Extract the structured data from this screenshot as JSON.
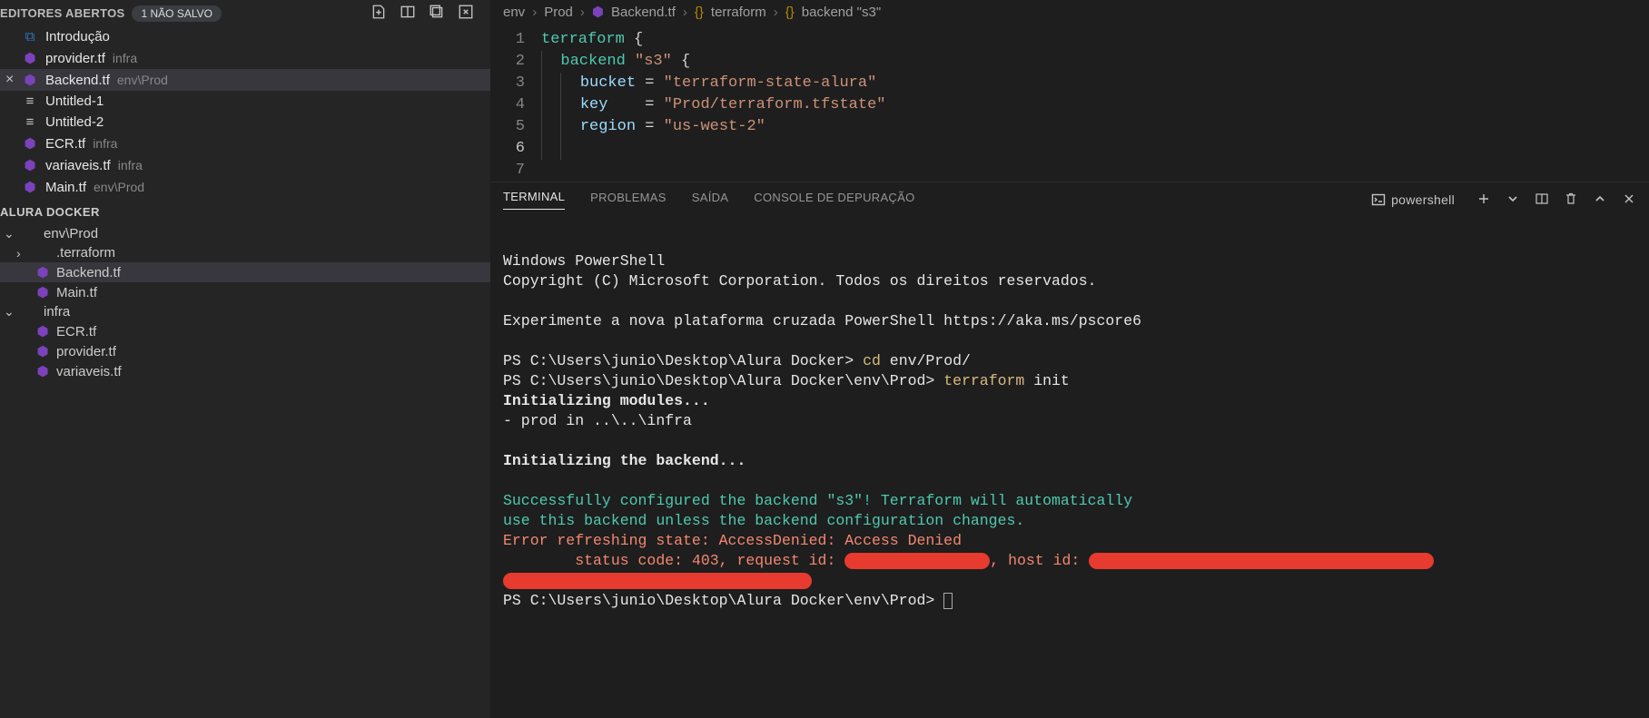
{
  "sidebar": {
    "open_editors_title": "EDITORES ABERTOS",
    "unsaved_badge": "1 NÃO SALVO",
    "items": [
      {
        "label": "Introdução",
        "path": "",
        "icon": "vs",
        "active": false
      },
      {
        "label": "provider.tf",
        "path": "infra",
        "icon": "tf",
        "active": false
      },
      {
        "label": "Backend.tf",
        "path": "env\\Prod",
        "icon": "tf",
        "active": true,
        "closeable": true
      },
      {
        "label": "Untitled-1",
        "path": "",
        "icon": "unt",
        "active": false
      },
      {
        "label": "Untitled-2",
        "path": "",
        "icon": "unt",
        "active": false
      },
      {
        "label": "ECR.tf",
        "path": "infra",
        "icon": "tf",
        "active": false
      },
      {
        "label": "variaveis.tf",
        "path": "infra",
        "icon": "tf",
        "active": false
      },
      {
        "label": "Main.tf",
        "path": "env\\Prod",
        "icon": "tf",
        "active": false
      }
    ],
    "explorer_title": "ALURA DOCKER",
    "tree": [
      {
        "label": "env\\Prod",
        "kind": "folder",
        "chev": "down",
        "indent": 1
      },
      {
        "label": ".terraform",
        "kind": "folder",
        "chev": "right",
        "indent": 2
      },
      {
        "label": "Backend.tf",
        "kind": "tf",
        "indent": 2,
        "active": true
      },
      {
        "label": "Main.tf",
        "kind": "tf",
        "indent": 2
      },
      {
        "label": "infra",
        "kind": "folder",
        "chev": "down",
        "indent": 1
      },
      {
        "label": "ECR.tf",
        "kind": "tf",
        "indent": 2
      },
      {
        "label": "provider.tf",
        "kind": "tf",
        "indent": 2
      },
      {
        "label": "variaveis.tf",
        "kind": "tf",
        "indent": 2
      }
    ]
  },
  "breadcrumbs": {
    "parts": [
      "env",
      "Prod",
      "Backend.tf",
      "terraform",
      "backend \"s3\""
    ]
  },
  "code": {
    "lines": [
      {
        "n": 1,
        "tokens": [
          [
            "kw",
            "terraform"
          ],
          [
            "pun",
            " {"
          ]
        ]
      },
      {
        "n": 2,
        "tokens": [
          [
            "pad",
            "  "
          ],
          [
            "kw",
            "backend"
          ],
          [
            "pun",
            " "
          ],
          [
            "str",
            "\"s3\""
          ],
          [
            "pun",
            " {"
          ]
        ]
      },
      {
        "n": 3,
        "tokens": [
          [
            "pad",
            "    "
          ],
          [
            "id",
            "bucket"
          ],
          [
            "pun",
            " = "
          ],
          [
            "str",
            "\"terraform-state-alura\""
          ]
        ]
      },
      {
        "n": 4,
        "tokens": [
          [
            "pad",
            "    "
          ],
          [
            "id",
            "key"
          ],
          [
            "pun",
            "    = "
          ],
          [
            "str",
            "\"Prod/terraform.tfstate\""
          ]
        ]
      },
      {
        "n": 5,
        "tokens": [
          [
            "pad",
            "    "
          ],
          [
            "id",
            "region"
          ],
          [
            "pun",
            " = "
          ],
          [
            "str",
            "\"us-west-2\""
          ]
        ]
      },
      {
        "n": 6,
        "tokens": [
          [
            "pad",
            "    "
          ]
        ],
        "current": true
      },
      {
        "n": 7,
        "tokens": []
      }
    ]
  },
  "panel": {
    "tabs": {
      "terminal": "TERMINAL",
      "problems": "PROBLEMAS",
      "output": "SAÍDA",
      "debug": "CONSOLE DE DEPURAÇÃO"
    },
    "shell_label": "powershell"
  },
  "terminal": {
    "l1": "Windows PowerShell",
    "l2": "Copyright (C) Microsoft Corporation. Todos os direitos reservados.",
    "l3": "Experimente a nova plataforma cruzada PowerShell https://aka.ms/pscore6",
    "p1_prompt": "PS C:\\Users\\junio\\Desktop\\Alura Docker> ",
    "p1_cmd": "cd ",
    "p1_arg": "env/Prod/",
    "p2_prompt": "PS C:\\Users\\junio\\Desktop\\Alura Docker\\env\\Prod> ",
    "p2_cmd": "terraform ",
    "p2_arg": "init",
    "init_mod": "Initializing modules...",
    "mod_line": "- prod in ..\\..\\infra",
    "init_be": "Initializing the backend...",
    "success1": "Successfully configured the backend \"s3\"! Terraform will automatically",
    "success2": "use this backend unless the backend configuration changes.",
    "err1": "Error refreshing state: AccessDenied: Access Denied",
    "err2a": "        status code: 403, request id: ",
    "err2b": ", host id: ",
    "p3_prompt": "PS C:\\Users\\junio\\Desktop\\Alura Docker\\env\\Prod> "
  }
}
